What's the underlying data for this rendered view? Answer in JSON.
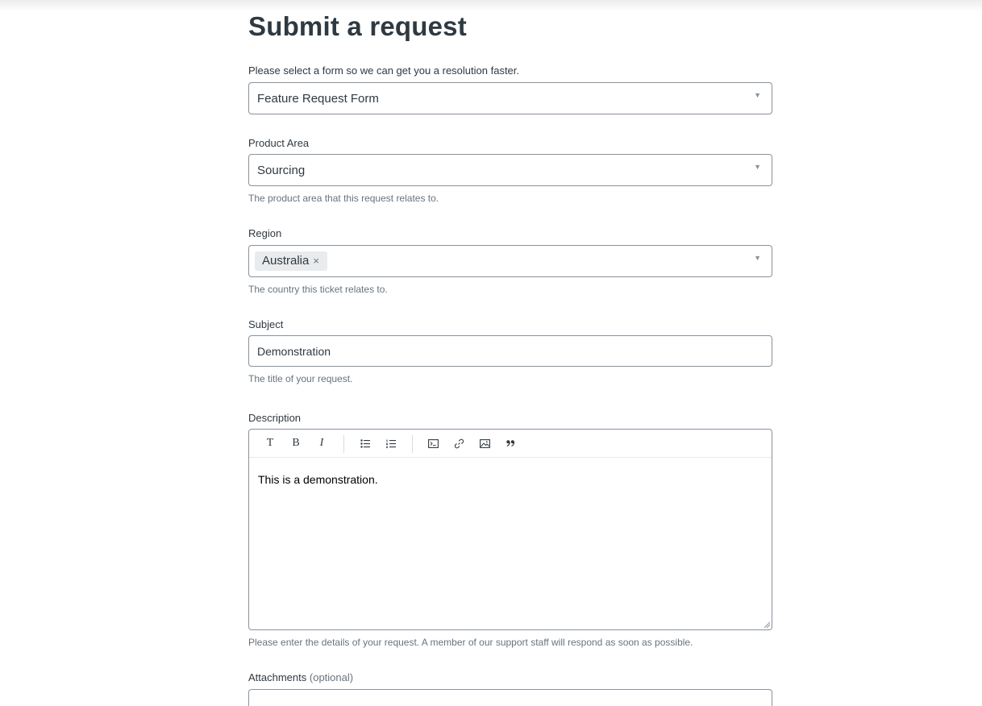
{
  "page": {
    "title": "Submit a request"
  },
  "form_selector": {
    "label": "Please select a form so we can get you a resolution faster.",
    "value": "Feature Request Form"
  },
  "product_area": {
    "label": "Product Area",
    "value": "Sourcing",
    "hint": "The product area that this request relates to."
  },
  "region": {
    "label": "Region",
    "tags": [
      "Australia"
    ],
    "tag_remove": "×",
    "hint": "The country this ticket relates to."
  },
  "subject": {
    "label": "Subject",
    "value": "Demonstration",
    "hint": "The title of your request."
  },
  "description": {
    "label": "Description",
    "toolbar": {
      "text_style": "T",
      "bold": "B",
      "italic": "I"
    },
    "content": "This is a demonstration.",
    "hint": "Please enter the details of your request. A member of our support staff will respond as soon as possible."
  },
  "attachments": {
    "label": "Attachments",
    "optional": "(optional)"
  },
  "icons": {
    "caret": "caret-down-icon",
    "bullet_list": "bullet-list-icon",
    "numbered_list": "numbered-list-icon",
    "code_block": "code-block-icon",
    "link": "link-icon",
    "image": "image-icon",
    "quote": "quote-icon"
  }
}
